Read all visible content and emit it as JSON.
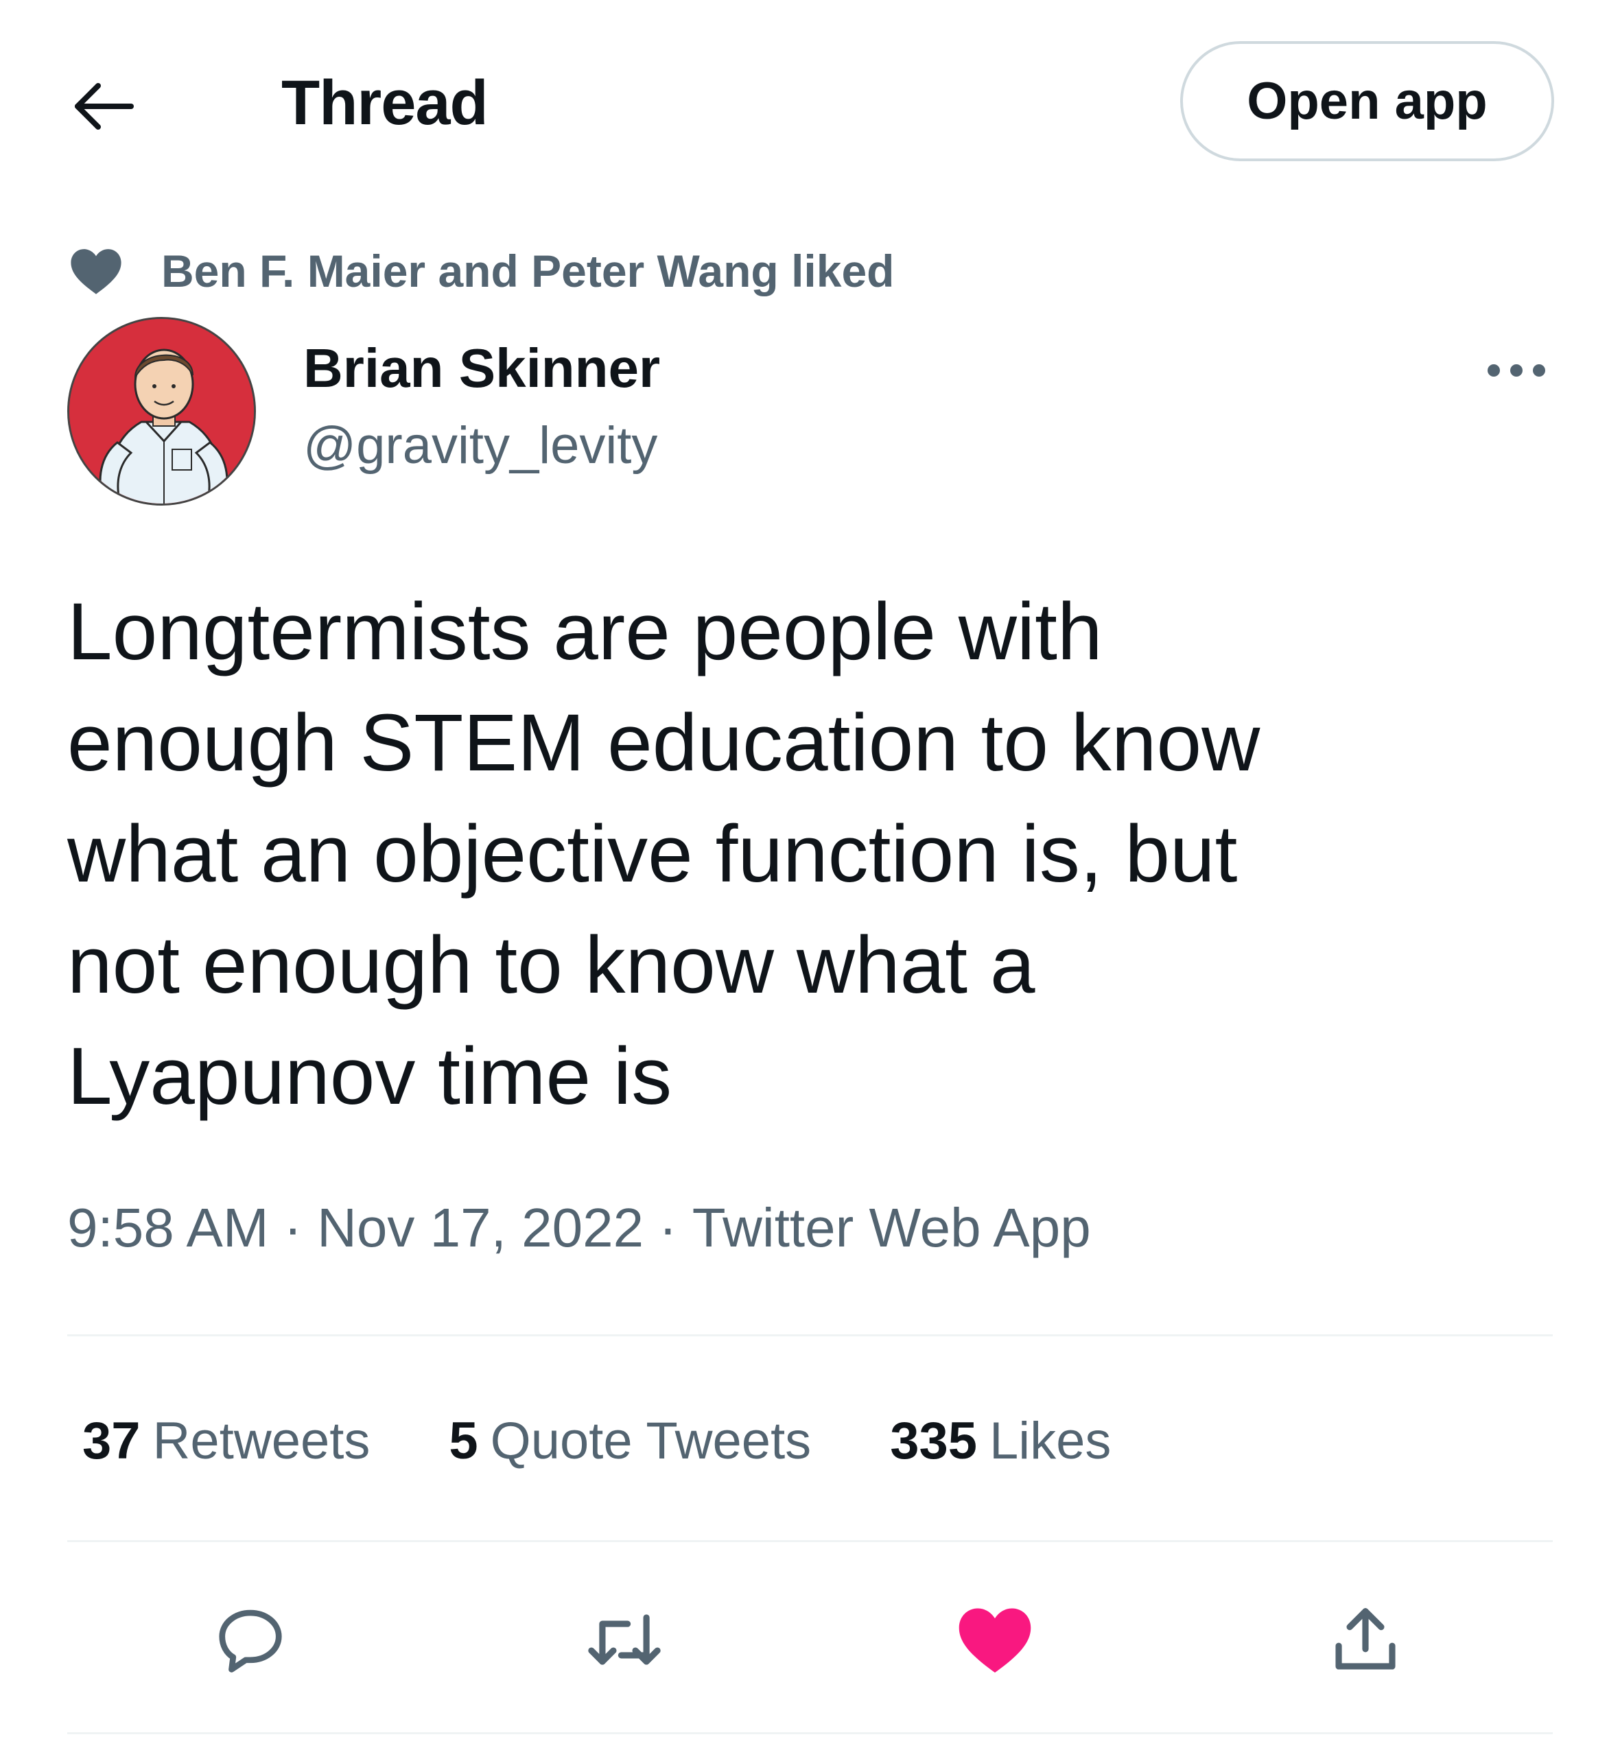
{
  "header": {
    "title": "Thread",
    "open_app_label": "Open app",
    "back_icon": "arrow-left-icon"
  },
  "social_context": {
    "icon": "heart-icon",
    "text": "Ben F. Maier and Peter Wang liked"
  },
  "author": {
    "name": "Brian Skinner",
    "handle": "@gravity_levity",
    "avatar_bg": "#d62f3d"
  },
  "tweet": {
    "lines": [
      "Longtermists are people with",
      "enough STEM education to know",
      "what an objective function is, but",
      "not enough to know what a",
      "Lyapunov time is"
    ],
    "time": "9:58 AM",
    "date": "Nov 17, 2022",
    "source": "Twitter Web App"
  },
  "stats": {
    "retweets_count": "37",
    "retweets_label": "Retweets",
    "quotes_count": "5",
    "quotes_label": "Quote Tweets",
    "likes_count": "335",
    "likes_label": "Likes"
  },
  "actions": {
    "reply_icon": "reply-icon",
    "retweet_icon": "retweet-icon",
    "like_icon": "heart-icon",
    "share_icon": "share-icon",
    "liked": true,
    "like_color": "#f91880"
  },
  "colors": {
    "text_primary": "#0f1419",
    "text_secondary": "#536471",
    "border": "#cfd9de"
  }
}
